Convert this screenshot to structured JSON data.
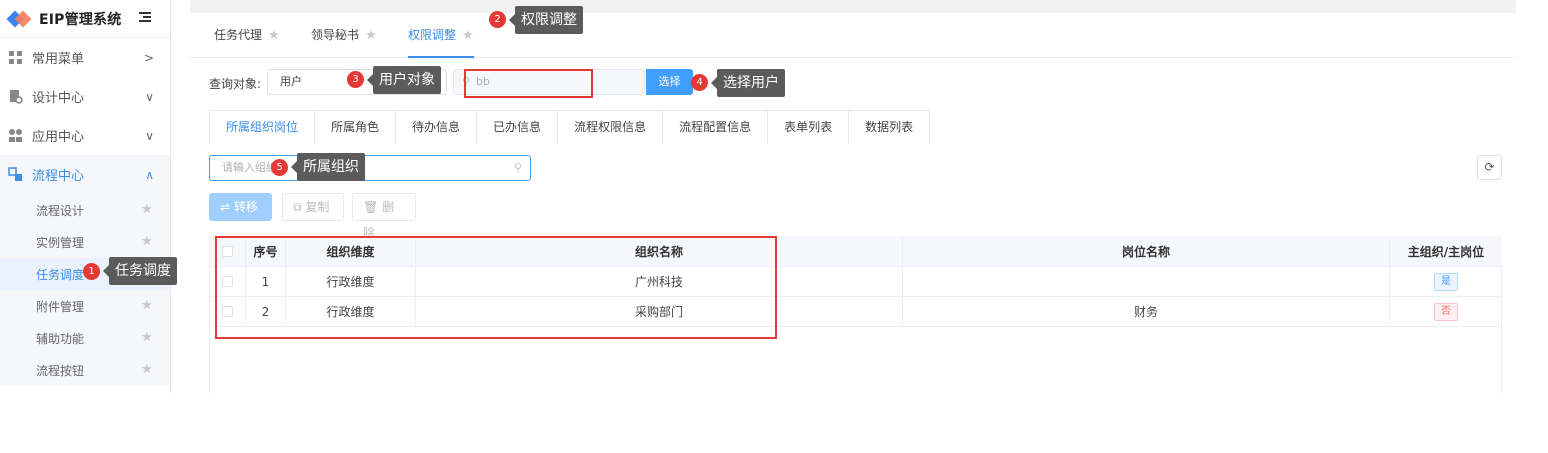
{
  "brand": {
    "title": "EIP管理系统"
  },
  "sidebar": {
    "menus": [
      {
        "label": "常用菜单",
        "chevron": ">"
      },
      {
        "label": "设计中心",
        "chevron": "∨"
      },
      {
        "label": "应用中心",
        "chevron": "∨"
      },
      {
        "label": "流程中心",
        "chevron": "∧"
      }
    ],
    "subitems": [
      {
        "label": "流程设计"
      },
      {
        "label": "实例管理"
      },
      {
        "label": "任务调度"
      },
      {
        "label": "附件管理"
      },
      {
        "label": "辅助功能"
      },
      {
        "label": "流程按钮"
      }
    ]
  },
  "tabs": [
    {
      "label": "任务代理"
    },
    {
      "label": "领导秘书"
    },
    {
      "label": "权限调整"
    }
  ],
  "query": {
    "label": "查询对象:",
    "object_value": "用户",
    "user_value": "bb",
    "select_button": "选择"
  },
  "subtabs": [
    {
      "label": "所属组织岗位"
    },
    {
      "label": "所属角色"
    },
    {
      "label": "待办信息"
    },
    {
      "label": "已办信息"
    },
    {
      "label": "流程权限信息"
    },
    {
      "label": "流程配置信息"
    },
    {
      "label": "表单列表"
    },
    {
      "label": "数据列表"
    }
  ],
  "org_search": {
    "placeholder": "请输入组织"
  },
  "toolbar": {
    "move": "转移",
    "copy": "复制",
    "delete": "删除"
  },
  "table": {
    "headers": {
      "index": "序号",
      "dimension": "组织维度",
      "org_name": "组织名称",
      "position": "岗位名称",
      "primary": "主组织/主岗位"
    },
    "rows": [
      {
        "index": "1",
        "dimension": "行政维度",
        "org_name": "广州科技",
        "position": "",
        "primary": "是"
      },
      {
        "index": "2",
        "dimension": "行政维度",
        "org_name": "采购部门",
        "position": "财务",
        "primary": "否"
      }
    ]
  },
  "annotations": [
    {
      "num": "1",
      "text": "任务调度"
    },
    {
      "num": "2",
      "text": "权限调整"
    },
    {
      "num": "3",
      "text": "用户对象"
    },
    {
      "num": "4",
      "text": "选择用户"
    },
    {
      "num": "5",
      "text": "所属组织"
    }
  ],
  "colors": {
    "accent": "#409eff",
    "annotation": "#e53935",
    "callout": "#5b5b5b"
  }
}
